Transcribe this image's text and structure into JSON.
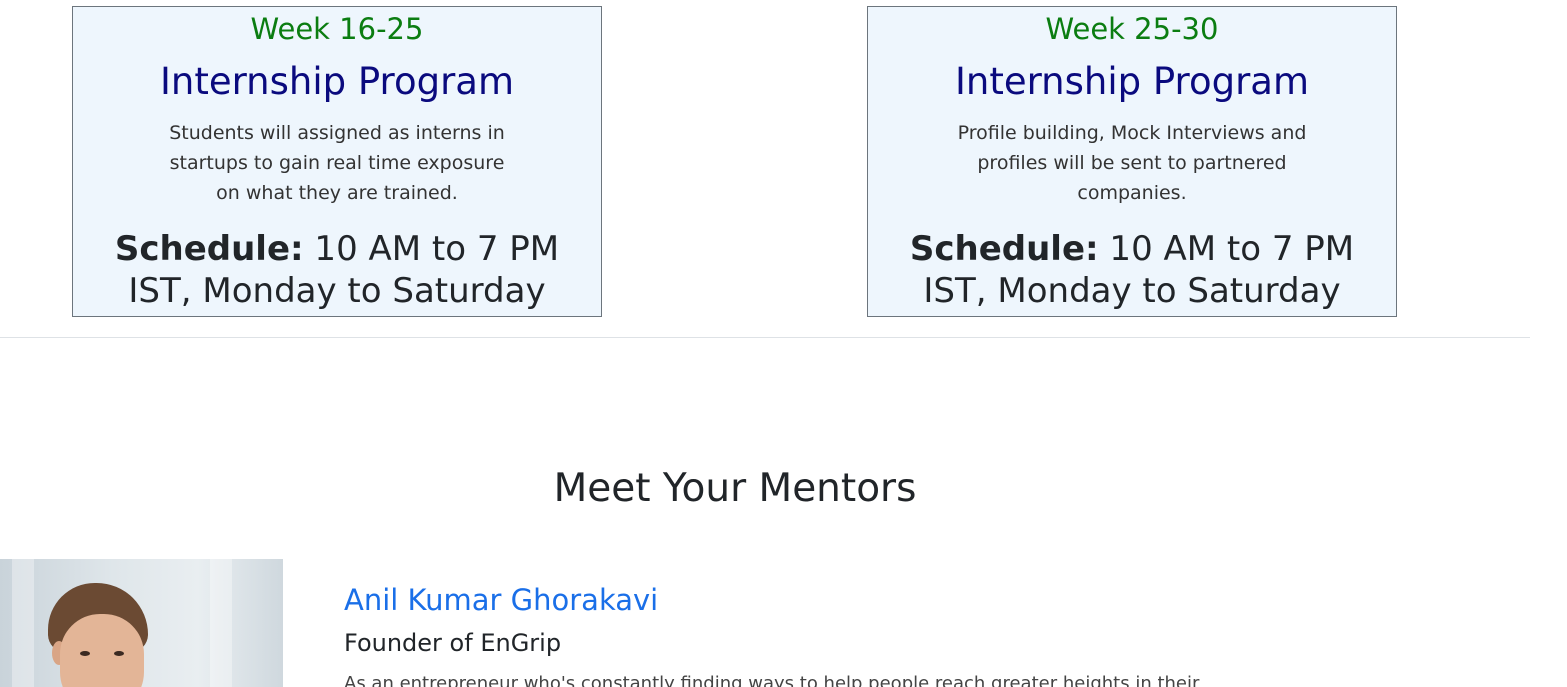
{
  "programs": [
    {
      "week": "Week 16-25",
      "title": "Internship Program",
      "description": "Students will assigned as interns in startups to gain real time exposure on what they are trained.",
      "schedule_label": "Schedule:",
      "schedule_value": " 10 AM to 7 PM IST, Monday to Saturday"
    },
    {
      "week": "Week 25-30",
      "title": "Internship Program",
      "description": "Profile building, Mock Interviews and profiles will be sent to partnered companies.",
      "schedule_label": "Schedule:",
      "schedule_value": " 10 AM to 7 PM IST, Monday to Saturday"
    }
  ],
  "mentors_section": {
    "title": "Meet Your Mentors"
  },
  "mentor": {
    "name": "Anil Kumar Ghorakavi",
    "role": "Founder of EnGrip",
    "bio": "As an entrepreneur who's constantly finding ways to help people reach greater heights in their"
  },
  "colors": {
    "week_green": "#0b7d11",
    "title_navy": "#0a0a7e",
    "card_bg": "#eef6fd",
    "link_blue": "#1a6fe8"
  }
}
